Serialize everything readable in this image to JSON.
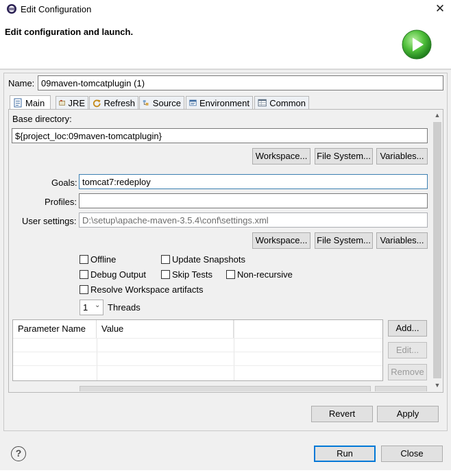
{
  "window": {
    "title": "Edit Configuration",
    "close_glyph": "✕"
  },
  "header": {
    "text": "Edit configuration and launch.",
    "icon": "run-launch-icon"
  },
  "name_field": {
    "label": "Name:",
    "value": "09maven-tomcatplugin (1)"
  },
  "tabs": [
    {
      "label": "Main",
      "icon": "main-tab-icon",
      "active": true
    },
    {
      "label": "JRE",
      "icon": "jre-icon"
    },
    {
      "label": "Refresh",
      "icon": "refresh-icon"
    },
    {
      "label": "Source",
      "icon": "source-icon"
    },
    {
      "label": "Environment",
      "icon": "environment-icon"
    },
    {
      "label": "Common",
      "icon": "common-icon"
    }
  ],
  "main": {
    "base_directory_label": "Base directory:",
    "base_directory_value": "${project_loc:09maven-tomcatplugin}",
    "buttons_row1": [
      "Workspace...",
      "File System...",
      "Variables..."
    ],
    "goals_label": "Goals:",
    "goals_value": "tomcat7:redeploy",
    "profiles_label": "Profiles:",
    "profiles_value": "",
    "user_settings_label": "User settings:",
    "user_settings_value": "D:\\setup\\apache-maven-3.5.4\\conf\\settings.xml",
    "buttons_row2": [
      "Workspace...",
      "File System...",
      "Variables..."
    ],
    "checkboxes": {
      "offline": {
        "label": "Offline",
        "checked": false
      },
      "update_snapshots": {
        "label": "Update Snapshots",
        "checked": false
      },
      "debug_output": {
        "label": "Debug Output",
        "checked": false
      },
      "skip_tests": {
        "label": "Skip Tests",
        "checked": false
      },
      "non_recursive": {
        "label": "Non-recursive",
        "checked": false
      },
      "resolve_workspace": {
        "label": "Resolve Workspace artifacts",
        "checked": false
      }
    },
    "threads_value": "1",
    "threads_label": "Threads",
    "table": {
      "columns": [
        "Parameter Name",
        "Value"
      ]
    },
    "table_buttons": {
      "add": "Add...",
      "edit": "Edit...",
      "remove": "Remove"
    }
  },
  "footer": {
    "revert": "Revert",
    "apply": "Apply",
    "run": "Run",
    "close": "Close",
    "help_glyph": "?"
  },
  "colors": {
    "accent_blue": "#0078d7",
    "run_icon_green": "#3aa335",
    "panel_bg": "#f0f0f0"
  }
}
